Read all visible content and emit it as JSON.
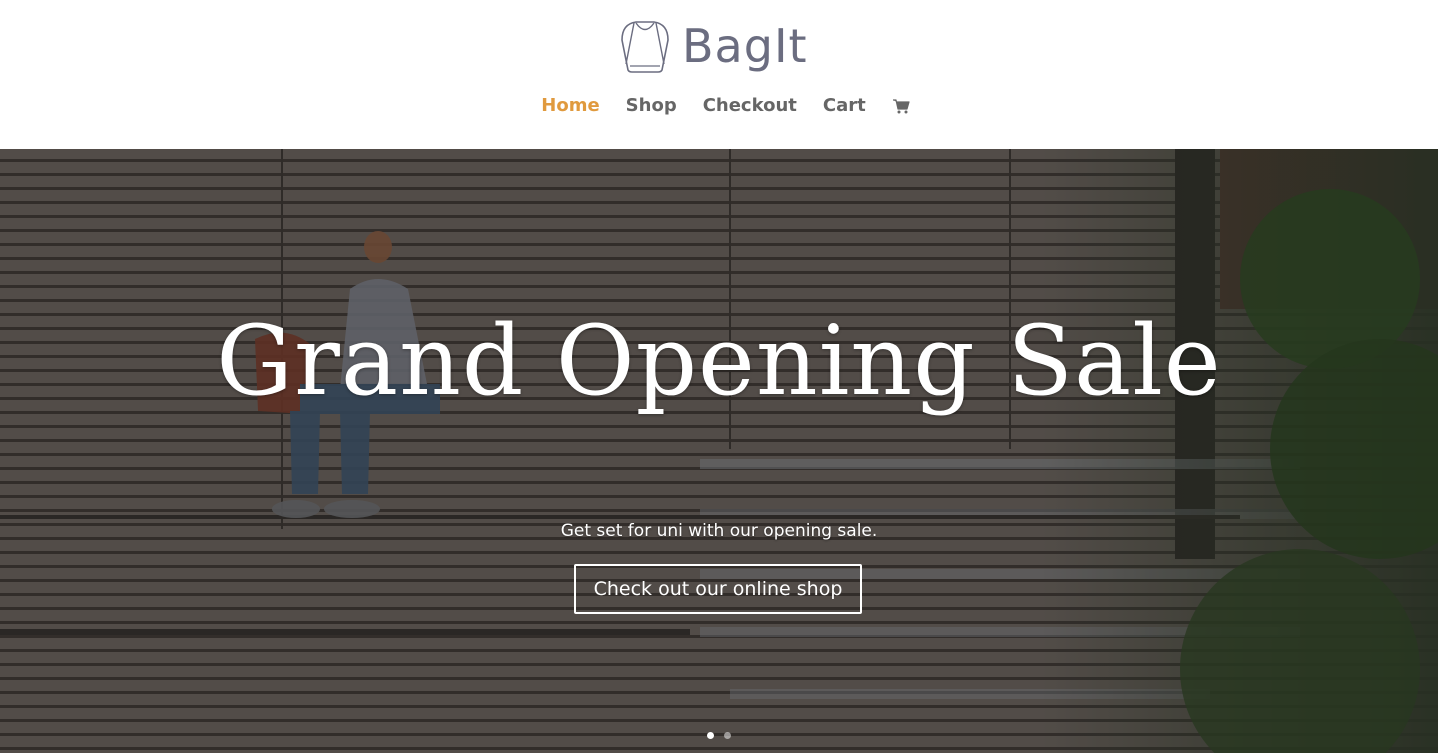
{
  "header": {
    "logo_text": "BagIt",
    "logo_icon": "backpack-icon",
    "nav": [
      {
        "label": "Home",
        "active": true
      },
      {
        "label": "Shop",
        "active": false
      },
      {
        "label": "Checkout",
        "active": false
      },
      {
        "label": "Cart",
        "active": false
      }
    ],
    "cart_icon": "cart-icon"
  },
  "hero": {
    "title": "Grand Opening Sale",
    "subtitle": "Get set for uni with our opening sale.",
    "button_label": "Check out our online shop",
    "slides": {
      "count": 2,
      "active_index": 0
    }
  },
  "colors": {
    "nav_active": "#e09a3e",
    "nav_text": "#666666",
    "logo_text": "#6b6d80",
    "hero_text": "#ffffff"
  }
}
